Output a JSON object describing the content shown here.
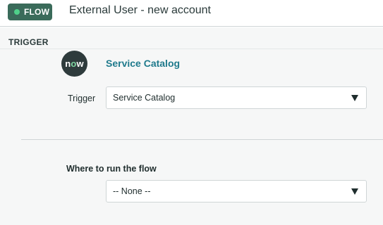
{
  "header": {
    "badge_label": "FLOW",
    "title": "External User - new account"
  },
  "section": {
    "title": "TRIGGER"
  },
  "trigger_source": {
    "logo_text_n": "n",
    "logo_text_o": "o",
    "logo_text_w": "w",
    "name": "Service Catalog"
  },
  "trigger_field": {
    "label": "Trigger",
    "value": "Service Catalog"
  },
  "run_field": {
    "label": "Where to run the flow",
    "value": "-- None --"
  },
  "colors": {
    "badge_bg": "#3a6b5a",
    "badge_dot": "#4fd18a",
    "link": "#1f7a8c",
    "logo_bg": "#2e3b3c"
  }
}
